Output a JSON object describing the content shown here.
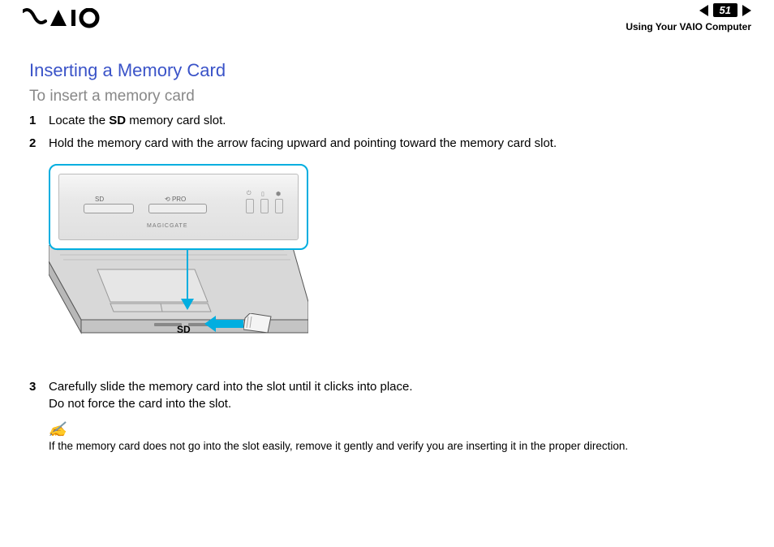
{
  "header": {
    "page_number": "51",
    "breadcrumb": "Using Your VAIO Computer",
    "logo_alt": "VAIO"
  },
  "section": {
    "title": "Inserting a Memory Card",
    "subtitle": "To insert a memory card"
  },
  "steps": [
    {
      "num": "1",
      "prefix": "Locate the ",
      "bold": "SD",
      "suffix": " memory card slot."
    },
    {
      "num": "2",
      "text": "Hold the memory card with the arrow facing upward and pointing toward the memory card slot."
    },
    {
      "num": "3",
      "line1": "Carefully slide the memory card into the slot until it clicks into place.",
      "line2": "Do not force the card into the slot."
    }
  ],
  "figure": {
    "slot_sd": "SD",
    "slot_pro": "PRO",
    "magicgate": "MAGICGATE",
    "sd_label": "SD"
  },
  "tip": {
    "icon": "✍",
    "text": "If the memory card does not go into the slot easily, remove it gently and verify you are inserting it in the proper direction."
  }
}
